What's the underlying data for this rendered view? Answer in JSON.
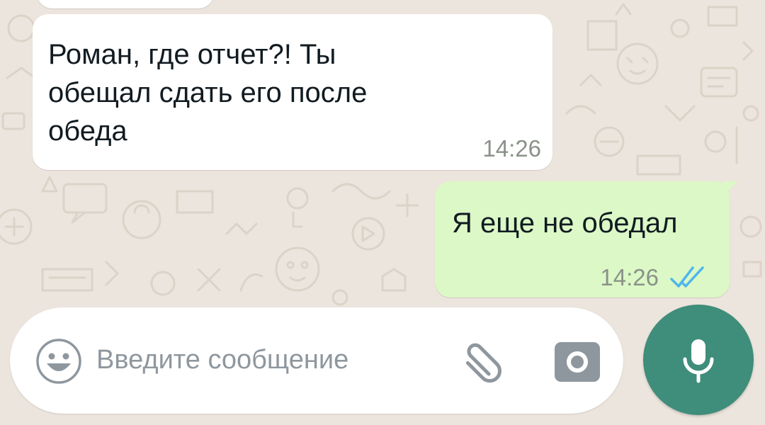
{
  "conversation": {
    "messages": [
      {
        "direction": "incoming",
        "text": "Роман, где отчет?! Ты\nобещал сдать его после\nобеда",
        "time": "14:26"
      },
      {
        "direction": "outgoing",
        "text": "Я еще не обедал",
        "time": "14:26",
        "status": "read",
        "status_icon": "double-check-icon"
      }
    ]
  },
  "composer": {
    "placeholder": "Введите сообщение",
    "value": "",
    "emoji_icon": "emoji-icon",
    "attach_icon": "paperclip-icon",
    "camera_icon": "camera-icon",
    "mic_icon": "microphone-icon"
  },
  "colors": {
    "wallpaper": "#ece5dd",
    "incoming_bubble": "#ffffff",
    "outgoing_bubble": "#dcf8c6",
    "read_ticks": "#4fb6ec",
    "mic_button": "#3f8d7b"
  }
}
